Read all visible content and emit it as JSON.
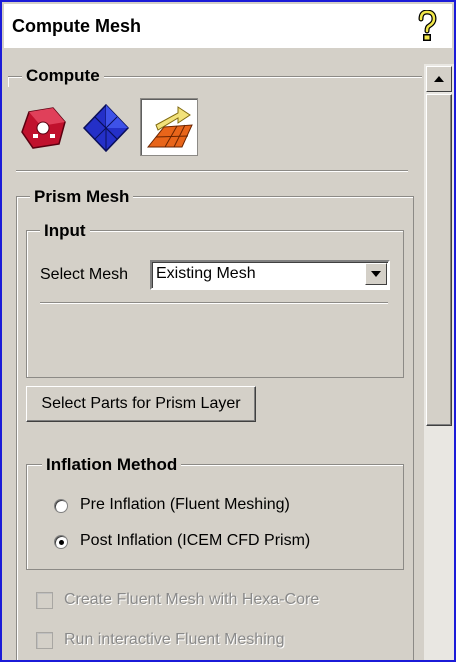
{
  "panel": {
    "title": "Compute Mesh"
  },
  "compute": {
    "legend": "Compute",
    "tools": [
      {
        "name": "volume-mesh-icon",
        "active": false
      },
      {
        "name": "octree-mesh-icon",
        "active": false
      },
      {
        "name": "prism-mesh-icon",
        "active": true
      }
    ]
  },
  "prism": {
    "legend": "Prism Mesh",
    "input": {
      "legend": "Input",
      "select_mesh_label": "Select Mesh",
      "select_mesh_value": "Existing Mesh"
    },
    "select_parts_button": "Select Parts for Prism Layer",
    "inflation": {
      "legend": "Inflation Method",
      "options": [
        {
          "label": "Pre Inflation (Fluent Meshing)",
          "selected": false
        },
        {
          "label": "Post Inflation (ICEM CFD Prism)",
          "selected": true
        }
      ]
    },
    "checkboxes": [
      {
        "label": "Create Fluent Mesh with Hexa-Core",
        "checked": false,
        "enabled": false
      },
      {
        "label": "Run interactive Fluent Meshing",
        "checked": false,
        "enabled": false
      }
    ]
  },
  "colors": {
    "frame_border": "#1b1bd8",
    "panel_bg": "#d4d0c8"
  }
}
